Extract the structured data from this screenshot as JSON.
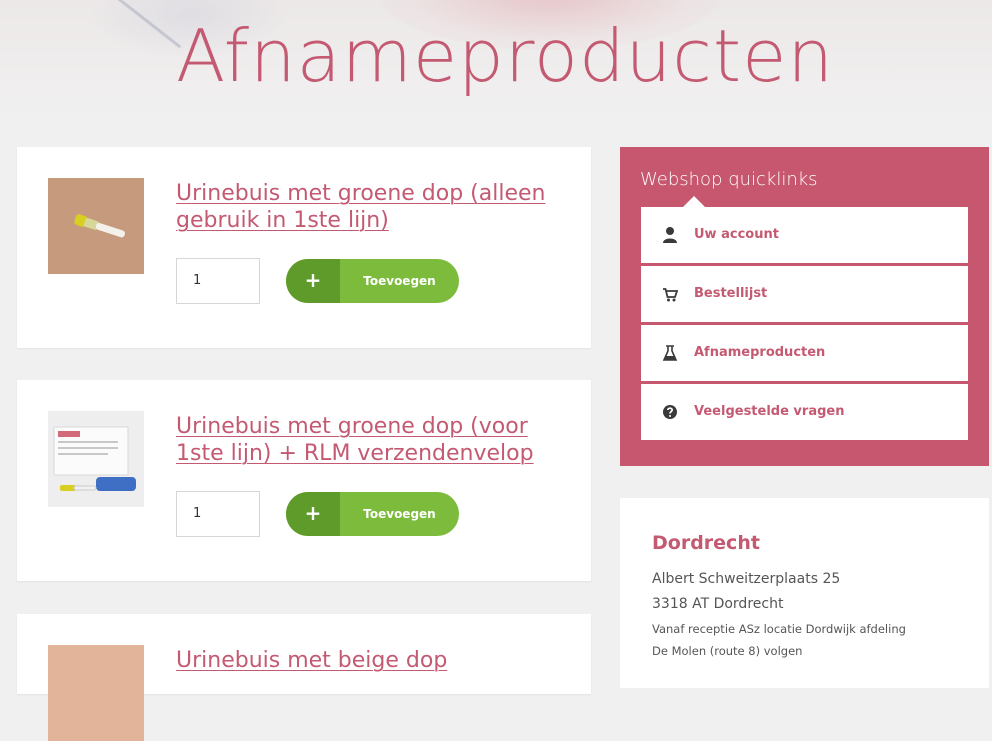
{
  "header": {
    "title": "Afnameproducten"
  },
  "products": [
    {
      "name_line1": "Urinebuis met groene dop (alleen",
      "name_line2": "gebruik in 1ste lijn)",
      "quantity": "1",
      "add_label": "Toevoegen",
      "add_icon": "+"
    },
    {
      "name_line1": "Urinebuis met groene dop (voor",
      "name_line2": "1ste lijn) + RLM verzendenvelop",
      "quantity": "1",
      "add_label": "Toevoegen",
      "add_icon": "+"
    },
    {
      "name_line1": "Urinebuis met beige dop",
      "name_line2": ""
    }
  ],
  "quicklinks": {
    "title": "Webshop quicklinks",
    "items": [
      {
        "label": "Uw account",
        "icon": "user-icon"
      },
      {
        "label": "Bestellijst",
        "icon": "cart-icon"
      },
      {
        "label": "Afnameproducten",
        "icon": "flask-icon"
      },
      {
        "label": "Veelgestelde vragen",
        "icon": "question-circle-icon"
      }
    ]
  },
  "location": {
    "title": "Dordrecht",
    "address_line1": "Albert Schweitzerplaats 25",
    "address_line2": "3318 AT Dordrecht",
    "directions_line1": "Vanaf receptie ASz locatie Dordwijk afdeling",
    "directions_line2": "De Molen (route 8) volgen"
  },
  "colors": {
    "accent": "#c45a72",
    "panel": "#c6576f",
    "button_green": "#7cbb3c",
    "button_green_dark": "#5f9b2a",
    "background": "#f1f0f0"
  }
}
